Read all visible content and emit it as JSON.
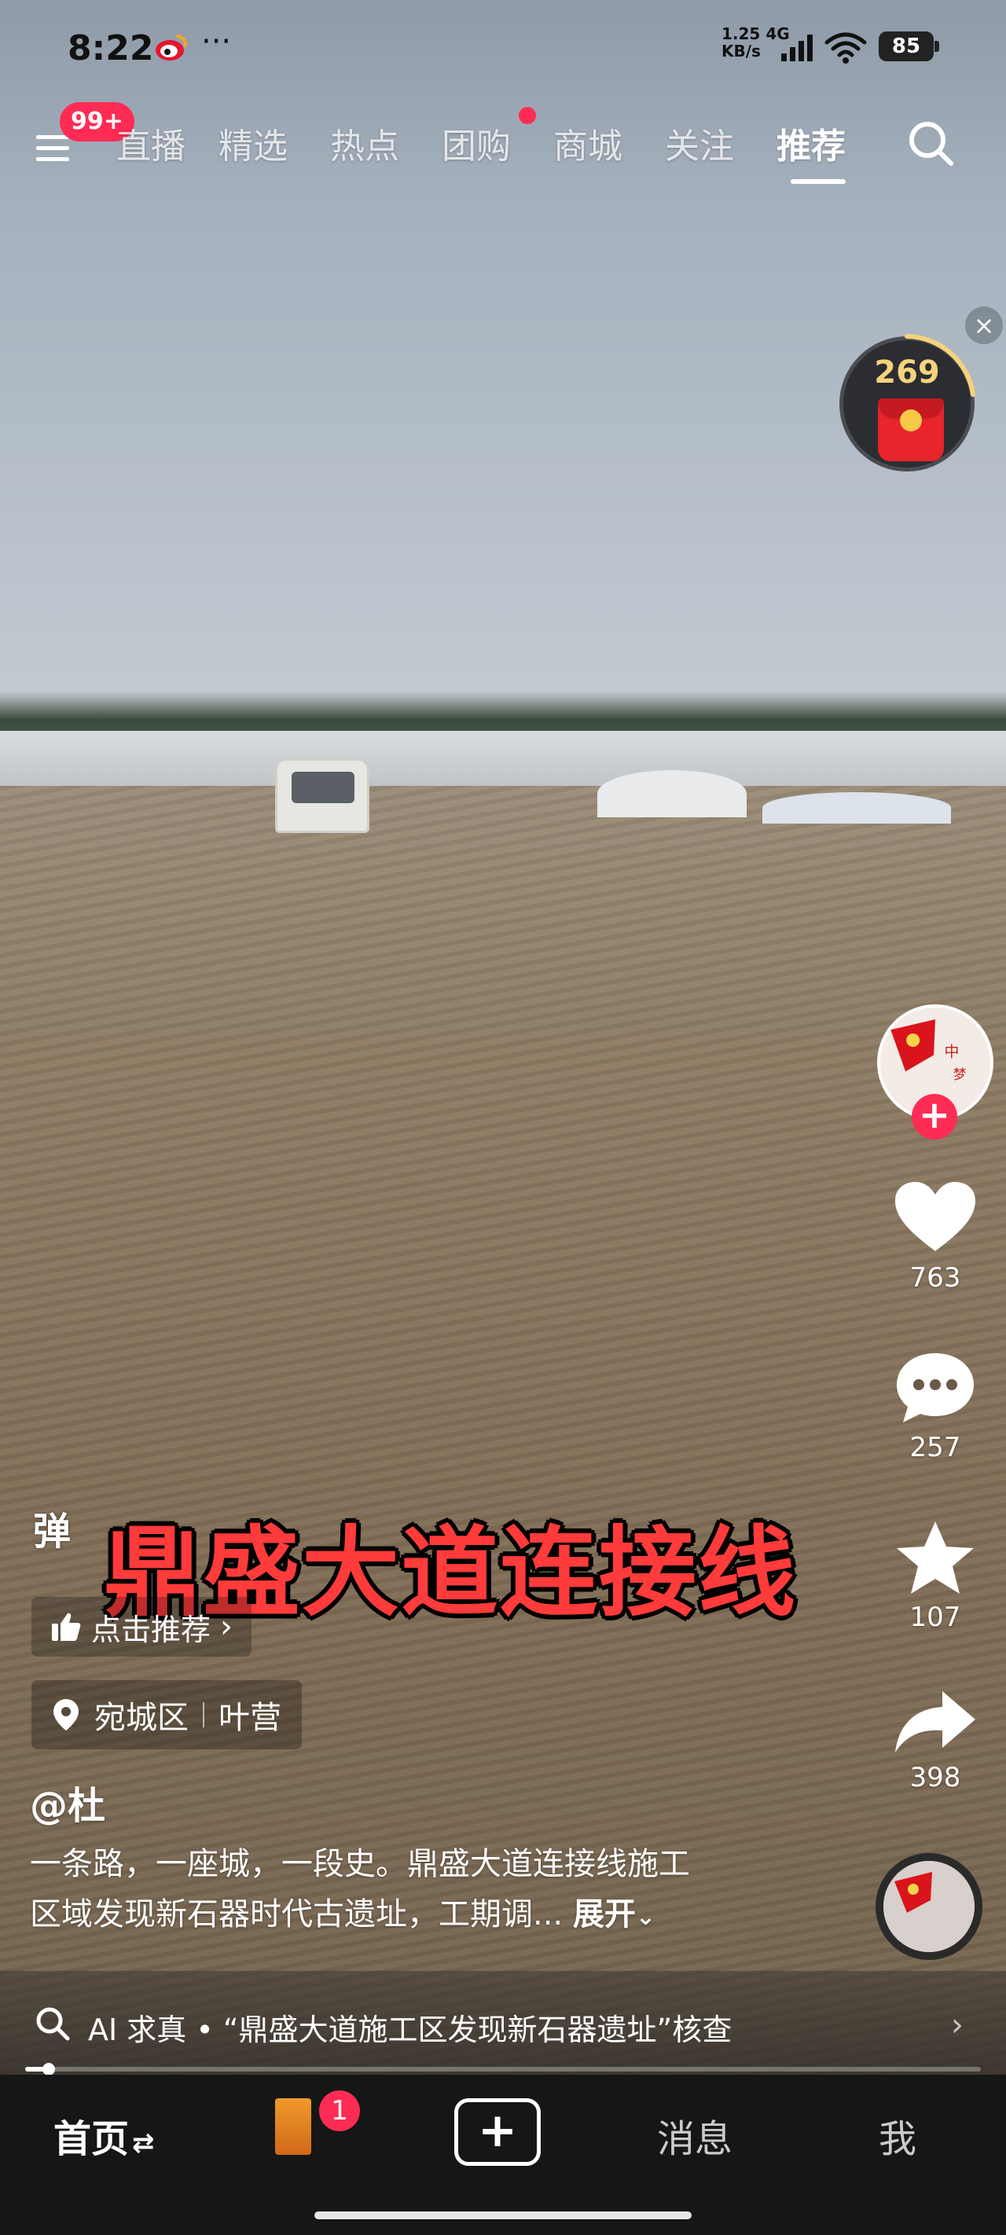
{
  "status_bar": {
    "time": "8:22",
    "dots": "···",
    "net_speed_value": "1.25",
    "net_speed_unit": "KB/s",
    "network": "4G",
    "battery": "85",
    "icons": [
      "weibo-icon",
      "signal-icon",
      "wifi-icon",
      "battery-icon"
    ]
  },
  "top_nav": {
    "menu_badge": "99+",
    "tabs": [
      {
        "label": "直播",
        "active": false
      },
      {
        "label": "精选",
        "active": false
      },
      {
        "label": "热点",
        "active": false
      },
      {
        "label": "团购",
        "active": false,
        "dot": true
      },
      {
        "label": "商城",
        "active": false
      },
      {
        "label": "关注",
        "active": false
      },
      {
        "label": "推荐",
        "active": true
      }
    ]
  },
  "red_packet": {
    "count": "269",
    "close": "×"
  },
  "actions": {
    "follow": "+",
    "likes": "763",
    "comments": "257",
    "favorites": "107",
    "shares": "398"
  },
  "video_overlay": {
    "danmu": "弹",
    "caption": "鼎盛大道连接线",
    "recommend_label": "点击推荐",
    "location_district": "宛城区",
    "location_place": "叶营",
    "author": "@杜",
    "description_line1": "一条路，一座城，一段史。鼎盛大道连接线施工",
    "description_line2": "区域发现新石器时代古遗址，工期调...",
    "expand_label": "展开"
  },
  "ai_bar": {
    "text": "AI 求真 • “鼎盛大道施工区发现新石器遗址”核查",
    "progress": 0.025
  },
  "tab_bar": {
    "home": "首页",
    "friends_badge": "1",
    "create": "+",
    "messages": "消息",
    "me": "我"
  },
  "colors": {
    "accent": "#fe2c55",
    "caption_red": "#ff3b3b",
    "tabbar_bg": "#161616"
  }
}
